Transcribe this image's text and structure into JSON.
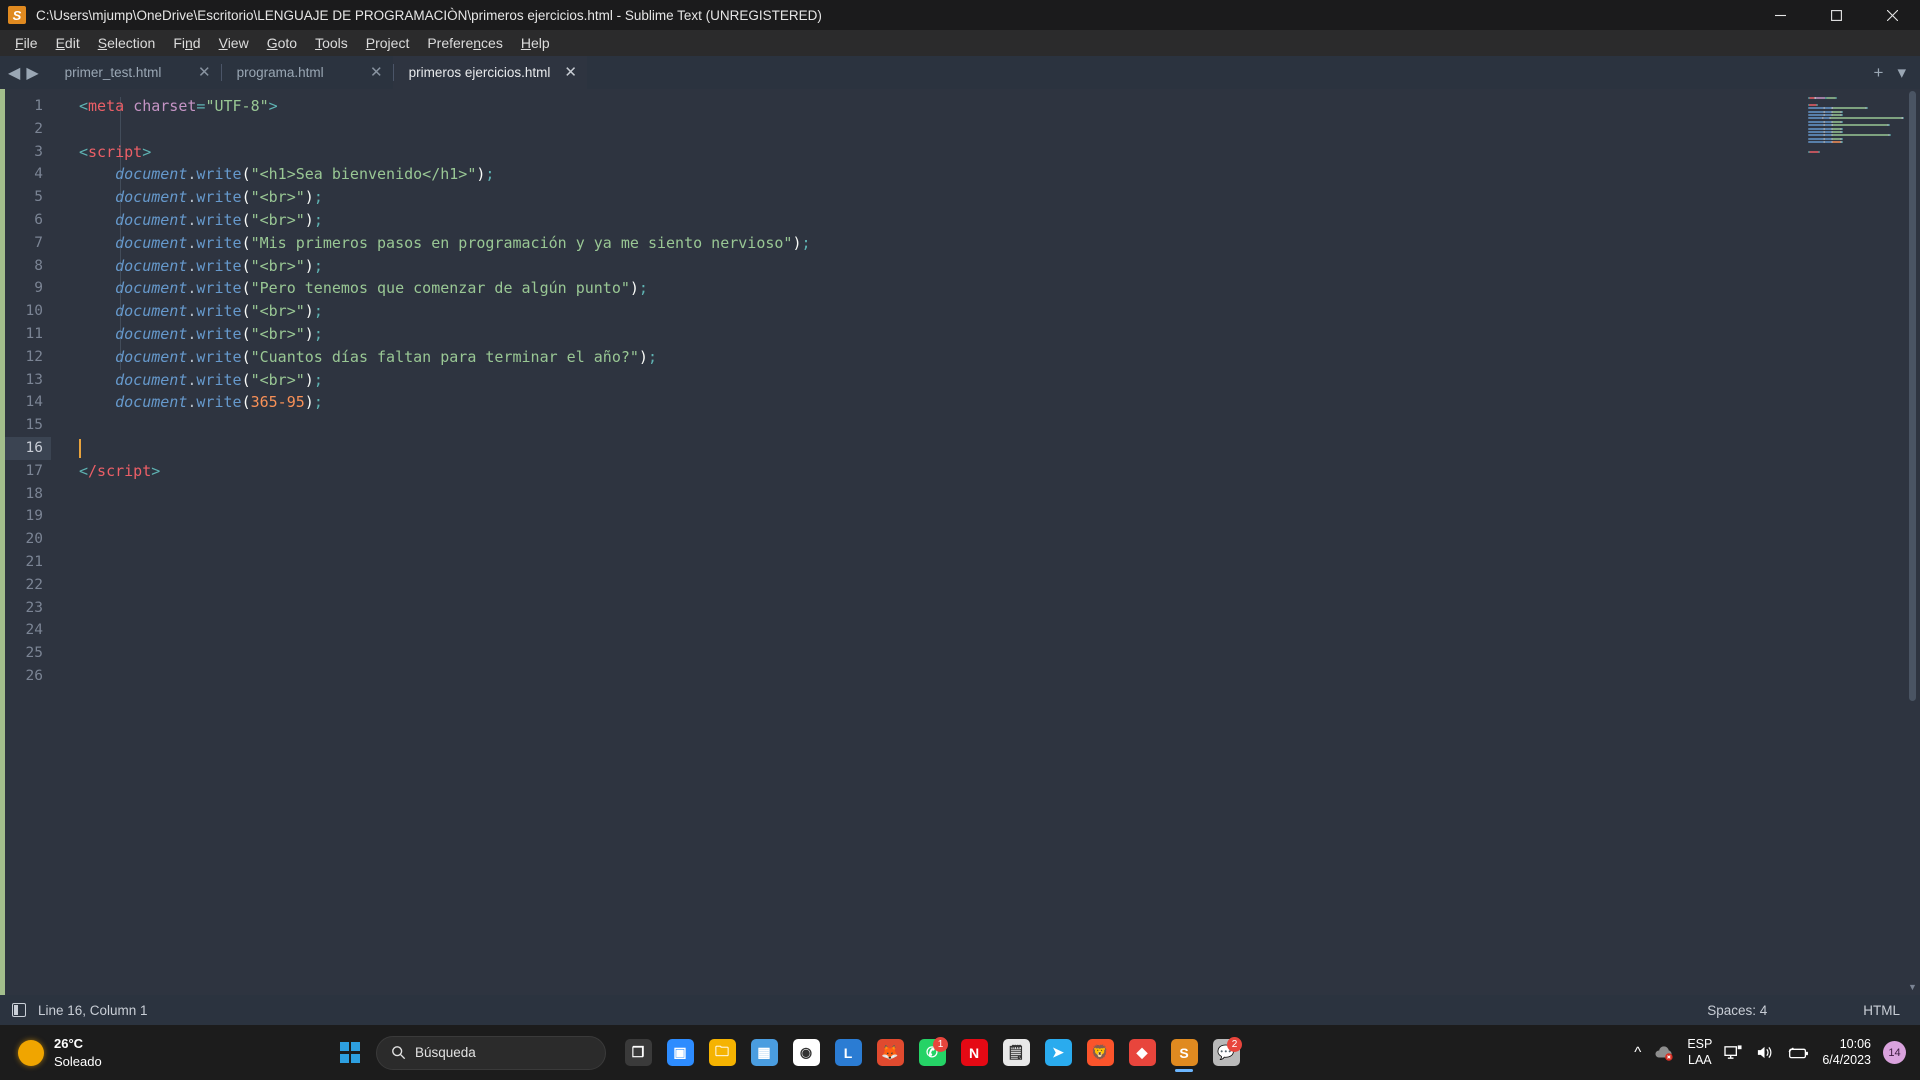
{
  "window": {
    "title": "C:\\Users\\mjump\\OneDrive\\Escritorio\\LENGUAJE DE PROGRAMACIÒN\\primeros ejercicios.html - Sublime Text (UNREGISTERED)",
    "minimize_label": "Minimize",
    "maximize_label": "Maximize",
    "close_label": "Close"
  },
  "menubar": {
    "items": [
      {
        "pre": "",
        "accel": "F",
        "post": "ile"
      },
      {
        "pre": "",
        "accel": "E",
        "post": "dit"
      },
      {
        "pre": "",
        "accel": "S",
        "post": "election"
      },
      {
        "pre": "Fi",
        "accel": "n",
        "post": "d"
      },
      {
        "pre": "",
        "accel": "V",
        "post": "iew"
      },
      {
        "pre": "",
        "accel": "G",
        "post": "oto"
      },
      {
        "pre": "",
        "accel": "T",
        "post": "ools"
      },
      {
        "pre": "",
        "accel": "P",
        "post": "roject"
      },
      {
        "pre": "Prefere",
        "accel": "n",
        "post": "ces"
      },
      {
        "pre": "",
        "accel": "H",
        "post": "elp"
      }
    ]
  },
  "tabs": {
    "nav_prev": "◀",
    "nav_next": "▶",
    "close_glyph": "✕",
    "new_tab_glyph": "+",
    "overflow_glyph": "▾",
    "items": [
      {
        "label": "primer_test.html",
        "active": false
      },
      {
        "label": "programa.html",
        "active": false
      },
      {
        "label": "primeros ejercicios.html",
        "active": true
      }
    ]
  },
  "editor": {
    "total_lines": 26,
    "current_line": 16,
    "lines": [
      {
        "n": 1,
        "tokens": [
          {
            "t": "punct",
            "v": "<"
          },
          {
            "t": "tag",
            "v": "meta"
          },
          {
            "t": "plain",
            "v": " "
          },
          {
            "t": "attr",
            "v": "charset"
          },
          {
            "t": "punct",
            "v": "="
          },
          {
            "t": "str",
            "v": "\"UTF-8\""
          },
          {
            "t": "punct",
            "v": ">"
          }
        ]
      },
      {
        "n": 2,
        "tokens": []
      },
      {
        "n": 3,
        "tokens": [
          {
            "t": "punct",
            "v": "<"
          },
          {
            "t": "tag",
            "v": "script"
          },
          {
            "t": "punct",
            "v": ">"
          }
        ]
      },
      {
        "n": 4,
        "tokens": [
          {
            "t": "var",
            "v": "    document"
          },
          {
            "t": "dot",
            "v": "."
          },
          {
            "t": "func",
            "v": "write"
          },
          {
            "t": "paren",
            "v": "("
          },
          {
            "t": "str",
            "v": "\"<h1>Sea bienvenido</h1>\""
          },
          {
            "t": "paren",
            "v": ")"
          },
          {
            "t": "punct",
            "v": ";"
          }
        ]
      },
      {
        "n": 5,
        "tokens": [
          {
            "t": "var",
            "v": "    document"
          },
          {
            "t": "dot",
            "v": "."
          },
          {
            "t": "func",
            "v": "write"
          },
          {
            "t": "paren",
            "v": "("
          },
          {
            "t": "str",
            "v": "\"<br>\""
          },
          {
            "t": "paren",
            "v": ")"
          },
          {
            "t": "punct",
            "v": ";"
          }
        ]
      },
      {
        "n": 6,
        "tokens": [
          {
            "t": "var",
            "v": "    document"
          },
          {
            "t": "dot",
            "v": "."
          },
          {
            "t": "func",
            "v": "write"
          },
          {
            "t": "paren",
            "v": "("
          },
          {
            "t": "str",
            "v": "\"<br>\""
          },
          {
            "t": "paren",
            "v": ")"
          },
          {
            "t": "punct",
            "v": ";"
          }
        ]
      },
      {
        "n": 7,
        "tokens": [
          {
            "t": "var",
            "v": "    document"
          },
          {
            "t": "dot",
            "v": "."
          },
          {
            "t": "func",
            "v": "write"
          },
          {
            "t": "paren",
            "v": "("
          },
          {
            "t": "str",
            "v": "\"Mis primeros pasos en programación y ya me siento nervioso\""
          },
          {
            "t": "paren",
            "v": ")"
          },
          {
            "t": "punct",
            "v": ";"
          }
        ]
      },
      {
        "n": 8,
        "tokens": [
          {
            "t": "var",
            "v": "    document"
          },
          {
            "t": "dot",
            "v": "."
          },
          {
            "t": "func",
            "v": "write"
          },
          {
            "t": "paren",
            "v": "("
          },
          {
            "t": "str",
            "v": "\"<br>\""
          },
          {
            "t": "paren",
            "v": ")"
          },
          {
            "t": "punct",
            "v": ";"
          }
        ]
      },
      {
        "n": 9,
        "tokens": [
          {
            "t": "var",
            "v": "    document"
          },
          {
            "t": "dot",
            "v": "."
          },
          {
            "t": "func",
            "v": "write"
          },
          {
            "t": "paren",
            "v": "("
          },
          {
            "t": "str",
            "v": "\"Pero tenemos que comenzar de algún punto\""
          },
          {
            "t": "paren",
            "v": ")"
          },
          {
            "t": "punct",
            "v": ";"
          }
        ]
      },
      {
        "n": 10,
        "tokens": [
          {
            "t": "var",
            "v": "    document"
          },
          {
            "t": "dot",
            "v": "."
          },
          {
            "t": "func",
            "v": "write"
          },
          {
            "t": "paren",
            "v": "("
          },
          {
            "t": "str",
            "v": "\"<br>\""
          },
          {
            "t": "paren",
            "v": ")"
          },
          {
            "t": "punct",
            "v": ";"
          }
        ]
      },
      {
        "n": 11,
        "tokens": [
          {
            "t": "var",
            "v": "    document"
          },
          {
            "t": "dot",
            "v": "."
          },
          {
            "t": "func",
            "v": "write"
          },
          {
            "t": "paren",
            "v": "("
          },
          {
            "t": "str",
            "v": "\"<br>\""
          },
          {
            "t": "paren",
            "v": ")"
          },
          {
            "t": "punct",
            "v": ";"
          }
        ]
      },
      {
        "n": 12,
        "tokens": [
          {
            "t": "var",
            "v": "    document"
          },
          {
            "t": "dot",
            "v": "."
          },
          {
            "t": "func",
            "v": "write"
          },
          {
            "t": "paren",
            "v": "("
          },
          {
            "t": "str",
            "v": "\"Cuantos días faltan para terminar el año?\""
          },
          {
            "t": "paren",
            "v": ")"
          },
          {
            "t": "punct",
            "v": ";"
          }
        ]
      },
      {
        "n": 13,
        "tokens": [
          {
            "t": "var",
            "v": "    document"
          },
          {
            "t": "dot",
            "v": "."
          },
          {
            "t": "func",
            "v": "write"
          },
          {
            "t": "paren",
            "v": "("
          },
          {
            "t": "str",
            "v": "\"<br>\""
          },
          {
            "t": "paren",
            "v": ")"
          },
          {
            "t": "punct",
            "v": ";"
          }
        ]
      },
      {
        "n": 14,
        "tokens": [
          {
            "t": "var",
            "v": "    document"
          },
          {
            "t": "dot",
            "v": "."
          },
          {
            "t": "func",
            "v": "write"
          },
          {
            "t": "paren",
            "v": "("
          },
          {
            "t": "num",
            "v": "365-95"
          },
          {
            "t": "paren",
            "v": ")"
          },
          {
            "t": "punct",
            "v": ";"
          }
        ]
      },
      {
        "n": 15,
        "tokens": []
      },
      {
        "n": 16,
        "tokens": []
      },
      {
        "n": 17,
        "tokens": [
          {
            "t": "punct",
            "v": "<"
          },
          {
            "t": "tag",
            "v": "/script"
          },
          {
            "t": "punct",
            "v": ">"
          }
        ]
      },
      {
        "n": 18,
        "tokens": []
      },
      {
        "n": 19,
        "tokens": []
      },
      {
        "n": 20,
        "tokens": []
      },
      {
        "n": 21,
        "tokens": []
      },
      {
        "n": 22,
        "tokens": []
      },
      {
        "n": 23,
        "tokens": []
      },
      {
        "n": 24,
        "tokens": []
      },
      {
        "n": 25,
        "tokens": []
      },
      {
        "n": 26,
        "tokens": []
      }
    ]
  },
  "statusbar": {
    "position": "Line 16, Column 1",
    "indentation": "Spaces: 4",
    "syntax": "HTML"
  },
  "taskbar": {
    "weather": {
      "temperature": "26°C",
      "condition": "Soleado"
    },
    "search": {
      "placeholder": "Búsqueda"
    },
    "apps": [
      {
        "name": "task-view",
        "glyph": "❐",
        "color": "#3a3a3a",
        "badge": null,
        "active": false
      },
      {
        "name": "zoom",
        "glyph": "▣",
        "color": "#2d8cff",
        "badge": null,
        "active": false
      },
      {
        "name": "file-explorer",
        "glyph": "🗀",
        "color": "#f5b301",
        "badge": null,
        "active": false
      },
      {
        "name": "microsoft-store",
        "glyph": "▦",
        "color": "#4a9de0",
        "badge": null,
        "active": false
      },
      {
        "name": "google-chrome",
        "glyph": "◉",
        "color": "#ffffff",
        "badge": null,
        "active": false
      },
      {
        "name": "libreoffice",
        "glyph": "L",
        "color": "#2b7cd3",
        "badge": null,
        "active": false
      },
      {
        "name": "firefox",
        "glyph": "🦊",
        "color": "#e04a2f",
        "badge": null,
        "active": false
      },
      {
        "name": "whatsapp",
        "glyph": "✆",
        "color": "#25d366",
        "badge": "1",
        "active": false
      },
      {
        "name": "netflix",
        "glyph": "N",
        "color": "#e50914",
        "badge": null,
        "active": false
      },
      {
        "name": "notes",
        "glyph": "🗒",
        "color": "#e8e8e8",
        "badge": null,
        "active": false
      },
      {
        "name": "telegram",
        "glyph": "➤",
        "color": "#2aabee",
        "badge": null,
        "active": false
      },
      {
        "name": "brave",
        "glyph": "🦁",
        "color": "#fb542b",
        "badge": null,
        "active": false
      },
      {
        "name": "pdf-reader",
        "glyph": "◆",
        "color": "#e8453c",
        "badge": null,
        "active": false
      },
      {
        "name": "sublime-text",
        "glyph": "S",
        "color": "#e08a20",
        "badge": null,
        "active": true
      },
      {
        "name": "messenger",
        "glyph": "💬",
        "color": "#b9b9b9",
        "badge": "2",
        "active": false
      }
    ],
    "tray": {
      "overflow_glyph": "^",
      "language_top": "ESP",
      "language_bottom": "LAA",
      "time": "10:06",
      "date": "6/4/2023",
      "notification_count": "14"
    }
  }
}
